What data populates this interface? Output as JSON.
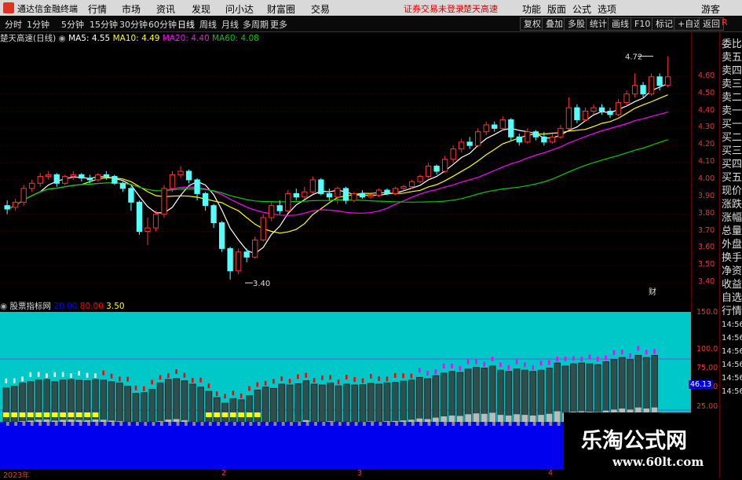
{
  "titlebar": {
    "app_name": "通达信金融终端",
    "menus": [
      "行情",
      "市场",
      "资讯",
      "发现",
      "问小达",
      "财富圈",
      "交易"
    ],
    "warning": "证券交易未登录",
    "warning2": "楚天高速",
    "right_menus": [
      "功能",
      "版面",
      "公式",
      "选项"
    ],
    "guest": "游客"
  },
  "toolbar": {
    "tabs": [
      "分时",
      "1分钟",
      "5分钟",
      "15分钟",
      "30分钟",
      "60分钟",
      "日线",
      "周线",
      "月线",
      "多周期",
      "更多"
    ],
    "active_tab": "日线",
    "buttons": [
      "复权",
      "叠加",
      "多股",
      "统计",
      "画线",
      "F10",
      "标记",
      "+自选",
      "返回"
    ]
  },
  "ma_legend": {
    "name": "楚天高速(日线)",
    "ma5": "MA5: 4.55",
    "ma10": "MA10: 4.49",
    "ma20": "MA20: 4.40",
    "ma60": "MA60: 4.08",
    "colors": {
      "ma5": "#ffffff",
      "ma10": "#ffff00",
      "ma20": "#ff00ff",
      "ma60": "#00cc00"
    }
  },
  "right_panel": [
    "委比",
    "卖五",
    "卖四",
    "卖三",
    "卖二",
    "卖一",
    "买一",
    "买二",
    "买三",
    "买四",
    "买五",
    "现价",
    "涨跌",
    "涨幅",
    "总量",
    "外盘",
    "换手",
    "净资",
    "收益",
    "自选",
    "行情",
    "14:56",
    "14:56",
    "14:56",
    "14:56",
    "14:56",
    "14:56"
  ],
  "right_panel_top": "R",
  "price_axis": [
    "4.60",
    "4.50",
    "4.40",
    "4.30",
    "4.20",
    "4.10",
    "4.00",
    "3.90",
    "3.80",
    "3.70",
    "3.60",
    "3.50",
    "3.40"
  ],
  "annotations": {
    "high": "4.72",
    "low": "3.40",
    "fin": "财"
  },
  "indicator_legend": {
    "name": "股票指标网",
    "v1": "20.00",
    "v2": "80.00",
    "v3": "3.50"
  },
  "indicator_axis": [
    "150.0",
    "100.0",
    "75.00",
    "50.00",
    "25.00"
  ],
  "indicator_marker": "46.13",
  "dates": [
    "2023年",
    "2",
    "3",
    "4"
  ],
  "watermark": {
    "line1": "乐淘公式网",
    "line2": "www.60lt.com"
  },
  "chart_data": {
    "type": "candlestick",
    "ylim": [
      3.35,
      4.75
    ],
    "candles": [
      [
        3.85,
        3.83,
        3.88,
        3.8
      ],
      [
        3.84,
        3.87,
        3.89,
        3.82
      ],
      [
        3.87,
        3.95,
        3.97,
        3.85
      ],
      [
        3.95,
        3.98,
        4.0,
        3.93
      ],
      [
        3.98,
        4.02,
        4.04,
        3.96
      ],
      [
        4.02,
        4.03,
        4.05,
        4.0
      ],
      [
        4.03,
        3.98,
        4.04,
        3.96
      ],
      [
        3.98,
        4.02,
        4.03,
        3.97
      ],
      [
        4.02,
        4.03,
        4.05,
        4.0
      ],
      [
        4.03,
        4.01,
        4.04,
        3.99
      ],
      [
        4.01,
        4.0,
        4.03,
        3.98
      ],
      [
        4.0,
        4.03,
        4.04,
        3.99
      ],
      [
        4.03,
        4.02,
        4.05,
        4.0
      ],
      [
        4.02,
        3.98,
        4.03,
        3.97
      ],
      [
        3.98,
        3.95,
        3.99,
        3.93
      ],
      [
        3.95,
        3.87,
        3.96,
        3.82
      ],
      [
        3.87,
        3.7,
        3.88,
        3.68
      ],
      [
        3.7,
        3.72,
        3.78,
        3.62
      ],
      [
        3.72,
        3.8,
        3.82,
        3.7
      ],
      [
        3.8,
        3.95,
        3.97,
        3.78
      ],
      [
        3.95,
        4.03,
        4.05,
        3.93
      ],
      [
        4.03,
        4.05,
        4.08,
        4.01
      ],
      [
        4.05,
        4.0,
        4.06,
        3.98
      ],
      [
        4.0,
        3.92,
        4.01,
        3.88
      ],
      [
        3.92,
        3.85,
        3.93,
        3.82
      ],
      [
        3.85,
        3.75,
        3.86,
        3.72
      ],
      [
        3.75,
        3.6,
        3.76,
        3.58
      ],
      [
        3.6,
        3.47,
        3.61,
        3.42
      ],
      [
        3.47,
        3.58,
        3.6,
        3.45
      ],
      [
        3.58,
        3.55,
        3.6,
        3.52
      ],
      [
        3.55,
        3.65,
        3.67,
        3.54
      ],
      [
        3.65,
        3.78,
        3.8,
        3.64
      ],
      [
        3.78,
        3.85,
        3.87,
        3.76
      ],
      [
        3.85,
        3.82,
        3.88,
        3.8
      ],
      [
        3.82,
        3.92,
        3.94,
        3.81
      ],
      [
        3.92,
        3.9,
        3.95,
        3.88
      ],
      [
        3.9,
        3.93,
        3.96,
        3.89
      ],
      [
        3.93,
        4.0,
        4.02,
        3.92
      ],
      [
        4.0,
        3.92,
        4.01,
        3.91
      ],
      [
        3.92,
        3.9,
        3.95,
        3.88
      ],
      [
        3.9,
        3.95,
        3.96,
        3.86
      ],
      [
        3.95,
        3.88,
        3.96,
        3.86
      ],
      [
        3.88,
        3.92,
        3.93,
        3.87
      ],
      [
        3.92,
        3.9,
        3.94,
        3.89
      ],
      [
        3.9,
        3.91,
        3.92,
        3.89
      ],
      [
        3.91,
        3.94,
        3.95,
        3.9
      ],
      [
        3.94,
        3.92,
        3.95,
        3.91
      ],
      [
        3.92,
        3.95,
        3.96,
        3.91
      ],
      [
        3.95,
        3.96,
        3.97,
        3.94
      ],
      [
        3.96,
        3.99,
        4.0,
        3.95
      ],
      [
        3.99,
        4.02,
        4.03,
        3.98
      ],
      [
        4.02,
        4.08,
        4.1,
        4.01
      ],
      [
        4.08,
        4.05,
        4.09,
        4.03
      ],
      [
        4.05,
        4.12,
        4.14,
        4.04
      ],
      [
        4.12,
        4.18,
        4.2,
        4.1
      ],
      [
        4.18,
        4.22,
        4.24,
        4.16
      ],
      [
        4.22,
        4.2,
        4.25,
        4.18
      ],
      [
        4.2,
        4.28,
        4.3,
        4.19
      ],
      [
        4.28,
        4.32,
        4.34,
        4.26
      ],
      [
        4.32,
        4.3,
        4.34,
        4.28
      ],
      [
        4.3,
        4.35,
        4.37,
        4.29
      ],
      [
        4.35,
        4.25,
        4.36,
        4.23
      ],
      [
        4.25,
        4.22,
        4.27,
        4.2
      ],
      [
        4.22,
        4.28,
        4.3,
        4.21
      ],
      [
        4.28,
        4.25,
        4.29,
        4.23
      ],
      [
        4.25,
        4.22,
        4.28,
        4.2
      ],
      [
        4.22,
        4.25,
        4.27,
        4.21
      ],
      [
        4.25,
        4.3,
        4.32,
        4.24
      ],
      [
        4.3,
        4.42,
        4.48,
        4.29
      ],
      [
        4.42,
        4.35,
        4.44,
        4.33
      ],
      [
        4.35,
        4.4,
        4.42,
        4.34
      ],
      [
        4.4,
        4.42,
        4.44,
        4.38
      ],
      [
        4.42,
        4.4,
        4.44,
        4.38
      ],
      [
        4.4,
        4.38,
        4.42,
        4.36
      ],
      [
        4.38,
        4.45,
        4.47,
        4.37
      ],
      [
        4.45,
        4.5,
        4.52,
        4.43
      ],
      [
        4.5,
        4.55,
        4.62,
        4.48
      ],
      [
        4.55,
        4.5,
        4.57,
        4.48
      ],
      [
        4.5,
        4.6,
        4.62,
        4.49
      ],
      [
        4.6,
        4.55,
        4.62,
        4.52
      ],
      [
        4.55,
        4.6,
        4.72,
        4.54
      ]
    ]
  }
}
